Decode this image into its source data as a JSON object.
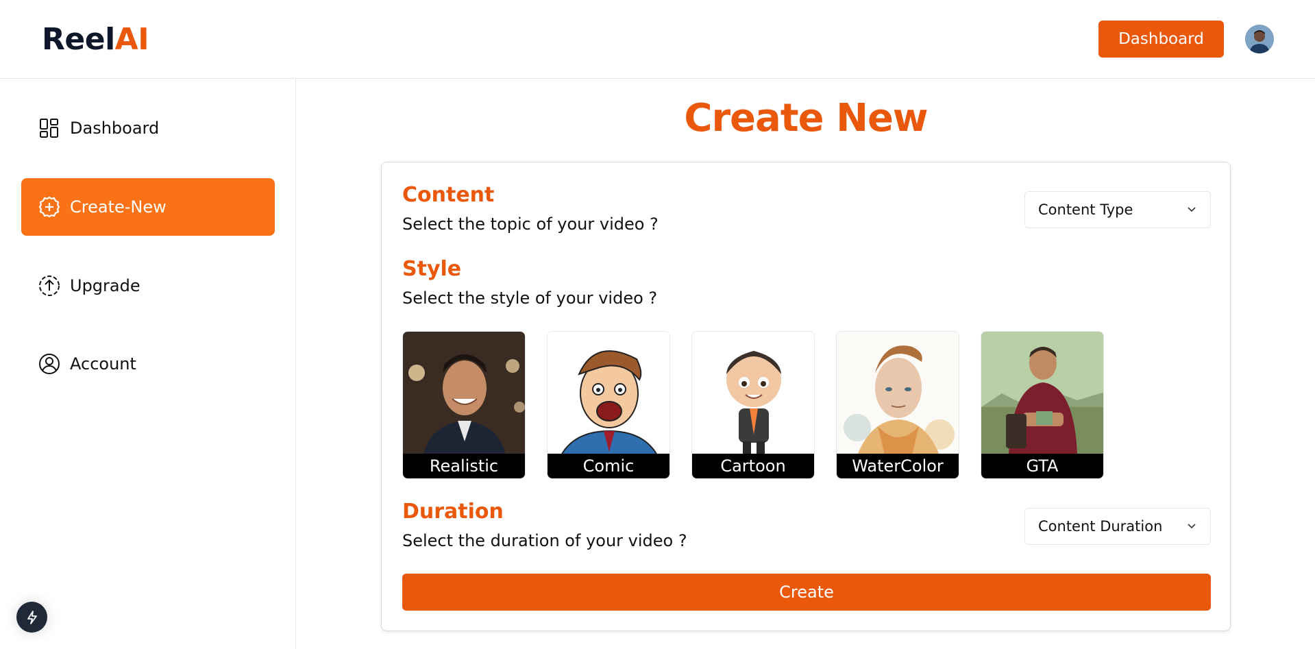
{
  "app": {
    "logo_primary": "Reel",
    "logo_accent": "AI"
  },
  "header": {
    "dashboard_button": "Dashboard"
  },
  "sidebar": {
    "items": [
      {
        "label": "Dashboard",
        "icon": "dashboard-grid-icon",
        "active": false
      },
      {
        "label": "Create-New",
        "icon": "plus-circle-icon",
        "active": true
      },
      {
        "label": "Upgrade",
        "icon": "upload-circle-icon",
        "active": false
      },
      {
        "label": "Account",
        "icon": "user-circle-icon",
        "active": false
      }
    ]
  },
  "main": {
    "title": "Create New",
    "content": {
      "title": "Content",
      "description": "Select the topic of your video ?",
      "select_value": "Content Type"
    },
    "style": {
      "title": "Style",
      "description": "Select the style of your video ?",
      "options": [
        {
          "label": "Realistic"
        },
        {
          "label": "Comic"
        },
        {
          "label": "Cartoon"
        },
        {
          "label": "WaterColor"
        },
        {
          "label": "GTA"
        }
      ]
    },
    "duration": {
      "title": "Duration",
      "description": "Select the duration of your video ?",
      "select_value": "Content Duration"
    },
    "create_button": "Create"
  },
  "colors": {
    "accent": "#ea580c",
    "accent_light": "#f97316",
    "dark": "#0f172a"
  }
}
